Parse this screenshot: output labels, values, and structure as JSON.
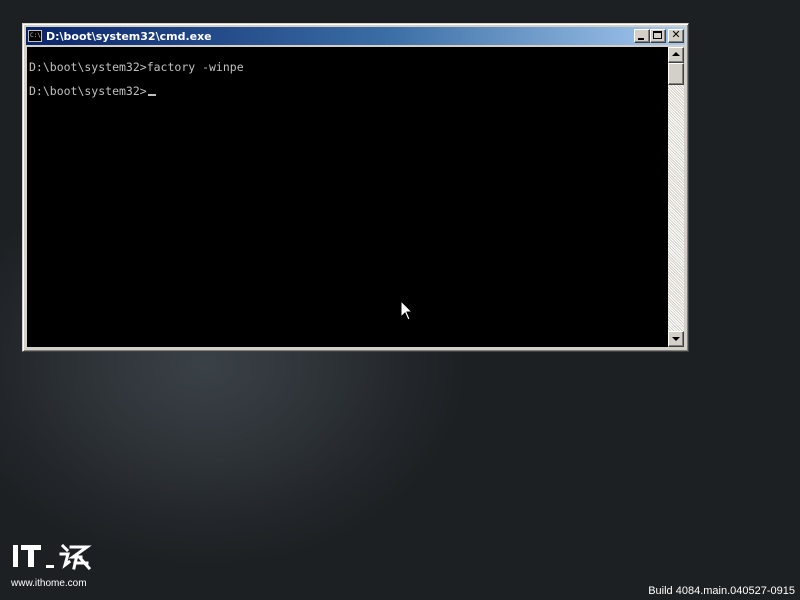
{
  "window": {
    "title": "D:\\boot\\system32\\cmd.exe",
    "icon": "console-icon",
    "icon_text": "C:\\",
    "buttons": [
      "minimize-icon",
      "maximize-icon",
      "close-icon"
    ],
    "close_glyph": "✕"
  },
  "console": {
    "lines": [
      "D:\\boot\\system32>factory -winpe",
      "D:\\boot\\system32>"
    ],
    "text_color": "#c0c0c0",
    "background": "#000000"
  },
  "desktop": {
    "watermark": {
      "logo_text": "IT之家",
      "url": "www.ithome.com"
    },
    "build_text": "Build 4084.main.040527-0915"
  },
  "colors": {
    "titlebar_start": "#0a246a",
    "titlebar_end": "#a6caf0",
    "window_face": "#d4d0c8"
  }
}
